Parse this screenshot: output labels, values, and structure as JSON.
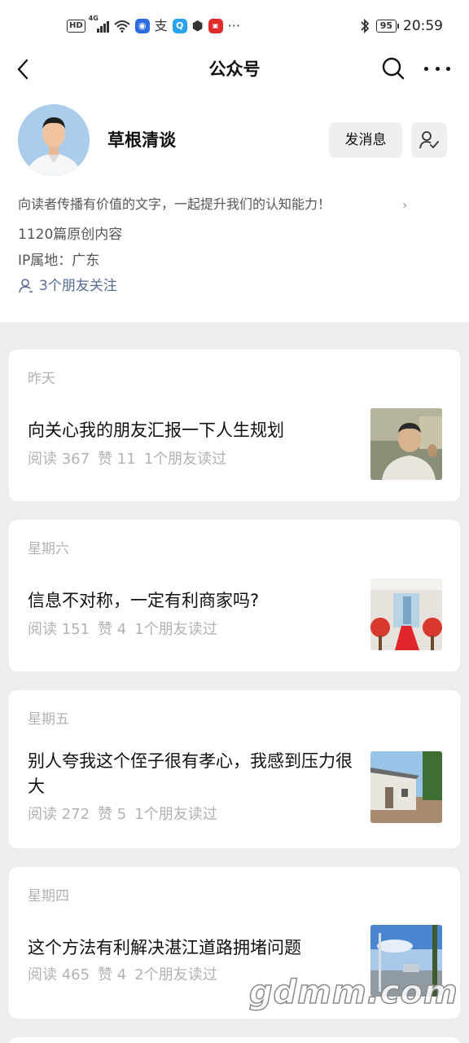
{
  "status_bar": {
    "network_badge": "HD",
    "network_type": "4G",
    "battery": "95",
    "time": "20:59"
  },
  "header": {
    "title": "公众号",
    "icons": [
      "back-arrow-icon",
      "search-icon",
      "more-icon"
    ]
  },
  "profile": {
    "name": "草根清谈",
    "message_button": "发消息",
    "description": "向读者传播有价值的文字，一起提升我们的认知能力！",
    "original_count": "1120篇原创内容",
    "ip_location": "IP属地：广东",
    "friends_following": "3个朋友关注",
    "link_color": "#576b95"
  },
  "articles": [
    {
      "date": "昨天",
      "title": "向关心我的朋友汇报一下人生规划",
      "reads": "阅读 367",
      "likes": "赞 11",
      "friends_read": "1个朋友读过"
    },
    {
      "date": "星期六",
      "title": "信息不对称，一定有利商家吗?",
      "reads": "阅读 151",
      "likes": "赞 4",
      "friends_read": "1个朋友读过"
    },
    {
      "date": "星期五",
      "title": "别人夸我这个侄子很有孝心，我感到压力很大",
      "reads": "阅读 272",
      "likes": "赞 5",
      "friends_read": "1个朋友读过"
    },
    {
      "date": "星期四",
      "title": "这个方法有利解决湛江道路拥堵问题",
      "reads": "阅读 465",
      "likes": "赞 4",
      "friends_read": "2个朋友读过"
    }
  ],
  "watermark": "gdmm.com"
}
